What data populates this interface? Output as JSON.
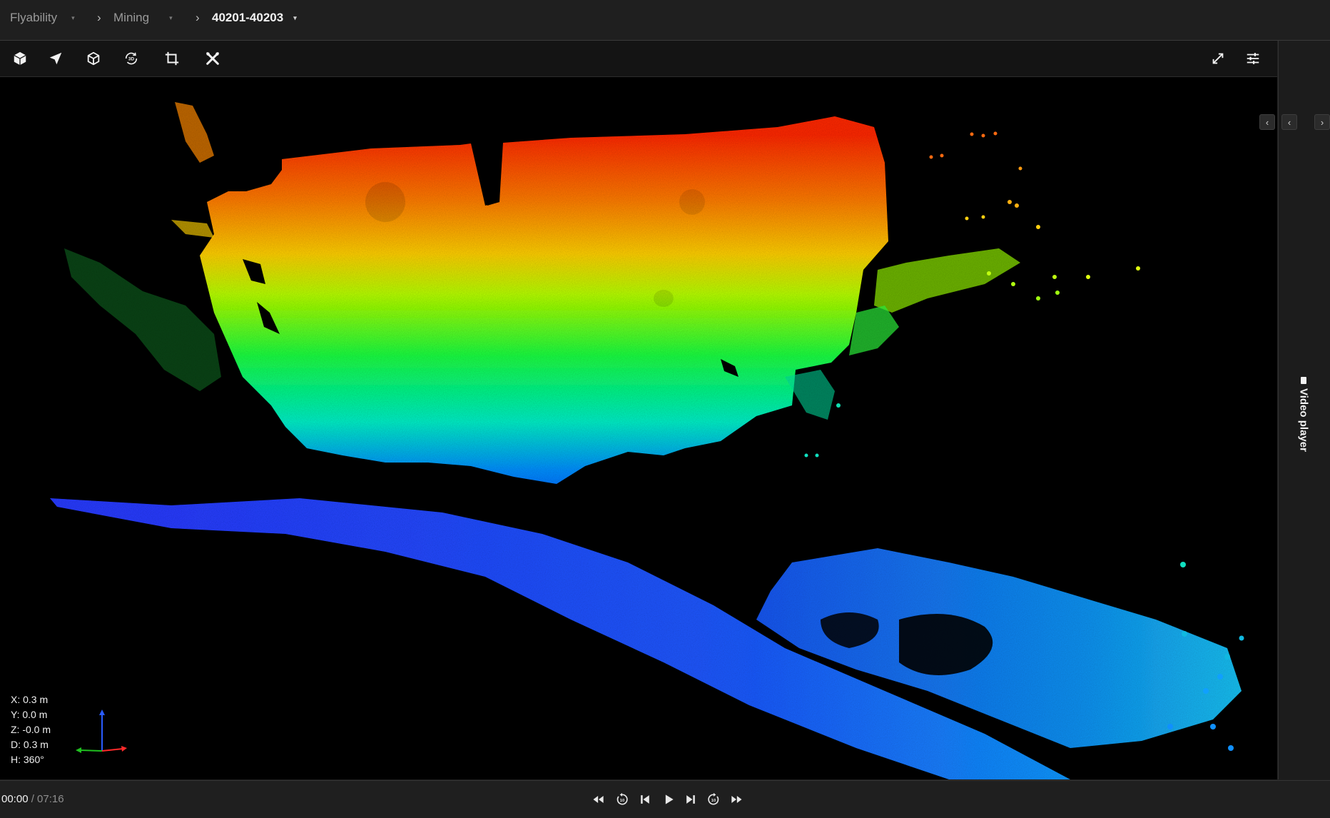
{
  "breadcrumb": {
    "items": [
      {
        "label": "Flyability"
      },
      {
        "label": "Mining"
      },
      {
        "label": "40201-40203"
      }
    ]
  },
  "toolbar": {
    "tools": [
      "solid-cube-icon",
      "navigate-icon",
      "cube-outline-icon",
      "3d-rotate-icon",
      "crop-icon",
      "measure-tools-icon"
    ],
    "right_tools": [
      "fullscreen-icon",
      "settings-sliders-icon"
    ]
  },
  "viewer": {
    "readout": {
      "x": "X: 0.3 m",
      "y": "Y: 0.0 m",
      "z": "Z: -0.0 m",
      "d": "D: 0.3 m",
      "h": "H: 360°"
    },
    "colors": {
      "background": "#000000",
      "gradient_top": "#ff3b00",
      "gradient_mid": "#9bff00",
      "gradient_low": "#00e0d0",
      "gradient_bottom": "#1a3bff"
    }
  },
  "side_panel": {
    "video_player_label": "Video player"
  },
  "player": {
    "current_time": "00:00",
    "total_time": "/ 07:16",
    "controls": [
      "fast-rewind-icon",
      "replay-10-icon",
      "skip-previous-icon",
      "play-icon",
      "skip-next-icon",
      "forward-10-icon",
      "fast-forward-icon"
    ]
  }
}
